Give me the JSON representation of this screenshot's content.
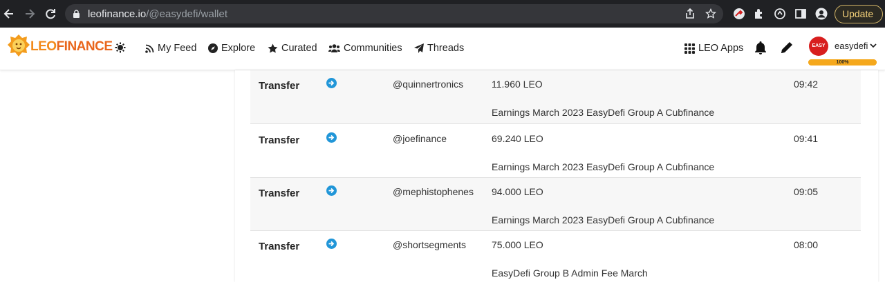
{
  "browser": {
    "url_host": "leofinance.io",
    "url_path": "/@easydefi/wallet",
    "update_label": "Update"
  },
  "site": {
    "logo_part1": "LEO",
    "logo_part2": "FINANCE",
    "nav": [
      {
        "label": "My Feed",
        "icon": "rss-icon"
      },
      {
        "label": "Explore",
        "icon": "compass-icon"
      },
      {
        "label": "Curated",
        "icon": "star-icon"
      },
      {
        "label": "Communities",
        "icon": "users-icon"
      },
      {
        "label": "Threads",
        "icon": "paper-plane-icon"
      }
    ],
    "apps_label": "LEO Apps",
    "avatar_text": "EASY",
    "username": "easydefi",
    "progress_label": "100%",
    "progress_value": 100,
    "accent_color": "#f5a81c"
  },
  "transactions": [
    {
      "type": "Transfer",
      "user": "@quinnertronics",
      "amount": "11.960 LEO",
      "memo": "Earnings March 2023 EasyDefi Group A Cubfinance",
      "time": "09:42"
    },
    {
      "type": "Transfer",
      "user": "@joefinance",
      "amount": "69.240 LEO",
      "memo": "Earnings March 2023 EasyDefi Group A Cubfinance",
      "time": "09:41"
    },
    {
      "type": "Transfer",
      "user": "@mephistophenes",
      "amount": "94.000 LEO",
      "memo": "Earnings March 2023 EasyDefi Group A Cubfinance",
      "time": "09:05"
    },
    {
      "type": "Transfer",
      "user": "@shortsegments",
      "amount": "75.000 LEO",
      "memo": "EasyDefi Group B Admin Fee March",
      "time": "08:00"
    }
  ]
}
